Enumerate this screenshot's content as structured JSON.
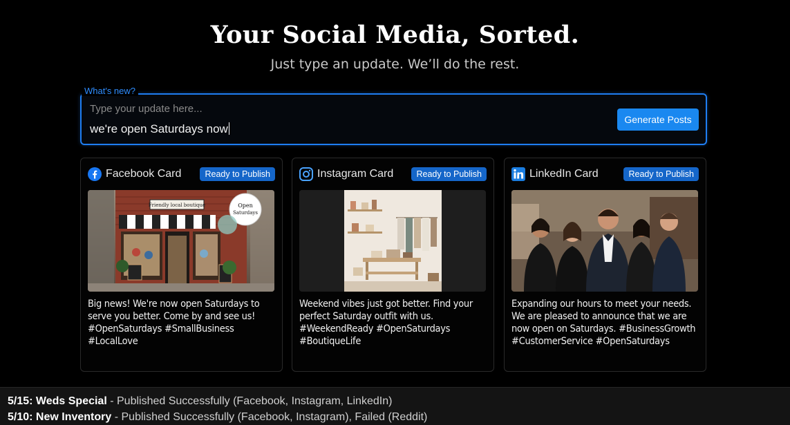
{
  "hero": {
    "title": "Your Social Media, Sorted.",
    "subtitle": "Just type an update. We’ll do the rest."
  },
  "composer": {
    "label": "What's new?",
    "placeholder": "Type your update here...",
    "value": "we're open Saturdays now",
    "generate_label": "Generate Posts"
  },
  "cards": [
    {
      "platform": "Facebook",
      "title": "Facebook Card",
      "status": "Ready to Publish",
      "icon": "facebook-icon",
      "image_overlay": {
        "sign": "Friendly local boutique",
        "sticker": "Open Saturdays"
      },
      "text": "Big news! We're now open Saturdays to serve you better. Come by and see us! #OpenSaturdays #SmallBusiness #LocalLove"
    },
    {
      "platform": "Instagram",
      "title": "Instagram Card",
      "status": "Ready to Publish",
      "icon": "instagram-icon",
      "text": "Weekend vibes just got better. Find your perfect Saturday outfit with us. #WeekendReady #OpenSaturdays #BoutiqueLife"
    },
    {
      "platform": "LinkedIn",
      "title": "LinkedIn Card",
      "status": "Ready to Publish",
      "icon": "linkedin-icon",
      "text": "Expanding our hours to meet your needs. We are pleased to announce that we are now open on Saturdays. #BusinessGrowth #CustomerService #OpenSaturdays"
    }
  ],
  "history": [
    {
      "title": "5/15: Weds Special",
      "detail": " - Published Successfully (Facebook, Instagram, LinkedIn)"
    },
    {
      "title": "5/10: New Inventory",
      "detail": " - Published Successfully (Facebook, Instagram), Failed (Reddit)"
    }
  ],
  "colors": {
    "accent": "#1a88f0",
    "badge": "#1566c9",
    "background": "#000000"
  }
}
